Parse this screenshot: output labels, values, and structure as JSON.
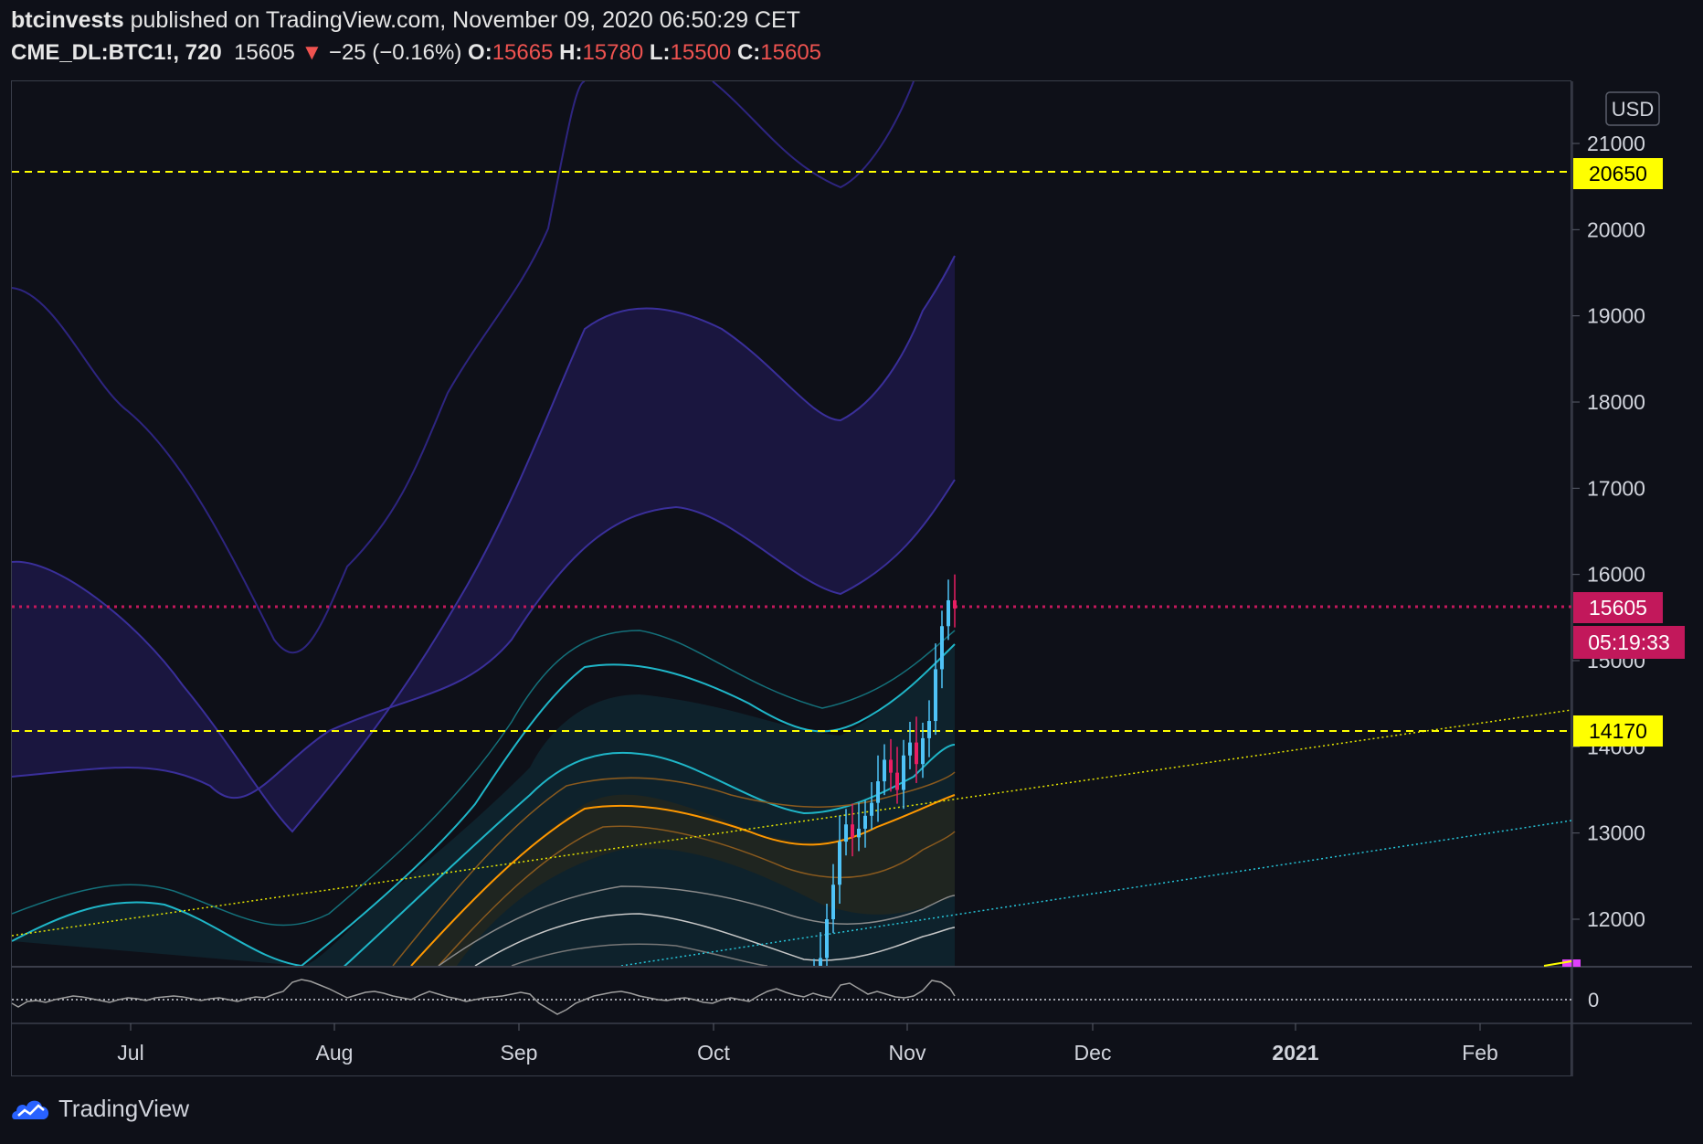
{
  "header": {
    "author": "btcinvests",
    "published_text": "published on TradingView.com, November 09, 2020 06:50:29 CET",
    "symbol": "CME_DL:BTC1!, 720",
    "last": "15605",
    "change_arrow": "▼",
    "change": "−25 (−0.16%)",
    "o_label": "O:",
    "o": "15665",
    "h_label": "H:",
    "h": "15780",
    "l_label": "L:",
    "l": "15500",
    "c_label": "C:",
    "c": "15605"
  },
  "currency": "USD",
  "price_labels": {
    "resistance": "20650",
    "last": "15605",
    "countdown": "05:19:33",
    "support": "14170"
  },
  "osc_zero": "0",
  "footer": {
    "brand": "TradingView"
  },
  "colors": {
    "background": "#0e1018",
    "up": "#4fc3f7",
    "down": "#e91e63",
    "level": "#ffff00",
    "last_price": "#c2185b",
    "band_purple": "#3a2f9a",
    "band_cyan": "#1fb6c8",
    "band_orange": "#ff9800"
  },
  "chart_data": {
    "type": "candlestick",
    "y_ticks": [
      "21000",
      "20000",
      "19000",
      "18000",
      "17000",
      "16000",
      "15000",
      "14000",
      "13000",
      "12000"
    ],
    "x_ticks": [
      "Jul",
      "Aug",
      "Sep",
      "Oct",
      "Nov",
      "Dec",
      "2021",
      "Feb"
    ],
    "ylim": [
      11450,
      22000
    ],
    "horizontal_levels": [
      20650,
      14170
    ],
    "last_price": 15605,
    "recent_closes": [
      11100,
      11300,
      11550,
      12000,
      12400,
      12900,
      13100,
      12950,
      13050,
      13200,
      13350,
      13600,
      13850,
      13700,
      13500,
      13900,
      14050,
      13800,
      14100,
      14300,
      14900,
      15400,
      15700,
      15605
    ]
  }
}
